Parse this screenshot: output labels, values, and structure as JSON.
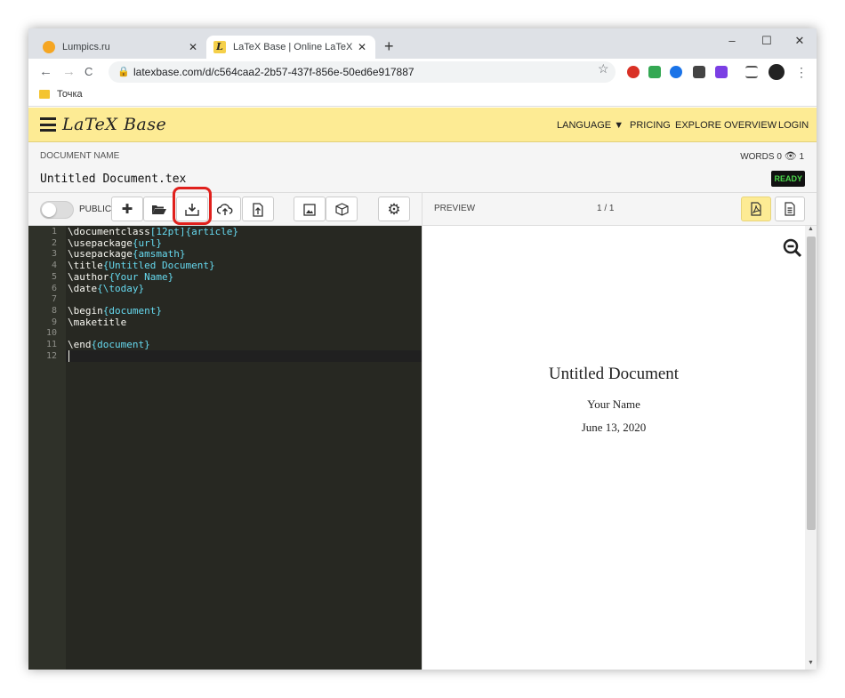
{
  "browser": {
    "tabs": [
      {
        "title": "Lumpics.ru",
        "favicon_color": "#f5a623"
      },
      {
        "title": "LaTeX Base | Online LaTeX Editor",
        "favicon_label": "L",
        "favicon_color": "#f5d04a"
      }
    ],
    "new_tab": "+",
    "window_controls": {
      "minimize": "–",
      "maximize": "☐",
      "close": "✕"
    },
    "nav": {
      "back": "←",
      "forward": "→",
      "reload": "C"
    },
    "url": "latexbase.com/d/c564caa2-2b57-437f-856e-50ed6e917887",
    "bookmark": "Точка"
  },
  "app": {
    "logo": "LaTeX Base",
    "menu": {
      "language": "LANGUAGE",
      "pricing": "PRICING",
      "explore": "EXPLORE",
      "overview": "OVERVIEW",
      "login": "LOGIN"
    },
    "document": {
      "label": "DOCUMENT NAME",
      "name": "Untitled Document.tex",
      "words_label": "WORDS",
      "words": "0",
      "viewers": "1",
      "status": "READY"
    },
    "toolbar": {
      "public_label": "PUBLIC",
      "public_on": false
    },
    "preview": {
      "label": "PREVIEW",
      "pages": "1 / 1"
    },
    "editor": {
      "lines": [
        {
          "n": "1",
          "cmd": "\\documentclass",
          "arg": "[12pt]{article}"
        },
        {
          "n": "2",
          "cmd": "\\usepackage",
          "arg": "{url}"
        },
        {
          "n": "3",
          "cmd": "\\usepackage",
          "arg": "{amsmath}"
        },
        {
          "n": "4",
          "cmd": "\\title",
          "arg": "{Untitled Document}"
        },
        {
          "n": "5",
          "cmd": "\\author",
          "arg": "{Your Name}"
        },
        {
          "n": "6",
          "cmd": "\\date",
          "arg": "{\\today}"
        },
        {
          "n": "7",
          "cmd": "",
          "arg": ""
        },
        {
          "n": "8",
          "cmd": "\\begin",
          "arg": "{document}"
        },
        {
          "n": "9",
          "cmd": "\\maketitle",
          "arg": ""
        },
        {
          "n": "10",
          "cmd": "",
          "arg": ""
        },
        {
          "n": "11",
          "cmd": "\\end",
          "arg": "{document}"
        },
        {
          "n": "12",
          "cmd": "",
          "arg": ""
        }
      ]
    },
    "pdf": {
      "title": "Untitled Document",
      "author": "Your Name",
      "date": "June 13, 2020"
    }
  },
  "colors": {
    "header_bg": "#fdeb94",
    "editor_bg": "#272822",
    "highlight": "#e0201c",
    "ready_fg": "#4bd64b"
  }
}
